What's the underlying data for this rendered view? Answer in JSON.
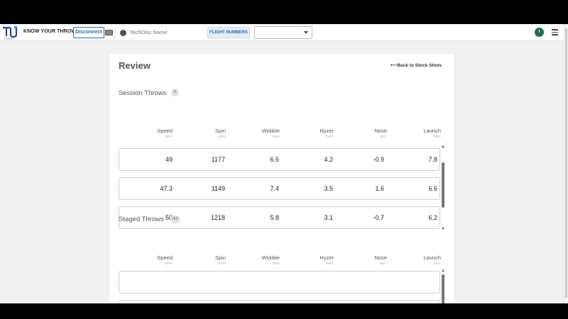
{
  "header": {
    "brand": "KNOW YOUR THROW",
    "disconnect_label": "Disconnect",
    "techdisc_placeholder": "TechDisc Name",
    "flight_numbers_label": "FLIGHT NUMBERS",
    "select_value": "",
    "avatar_initial": "I"
  },
  "review": {
    "title": "Review",
    "back_link": "⟵Back to Stock Shots"
  },
  "columns": [
    {
      "name": "Speed",
      "unit": "MPH"
    },
    {
      "name": "Spin",
      "unit": "RPM"
    },
    {
      "name": "Wobble",
      "unit": "DEG"
    },
    {
      "name": "Hyzer",
      "unit": "DEG"
    },
    {
      "name": "Nose",
      "unit": "DEG"
    },
    {
      "name": "Launch",
      "unit": "DEG"
    }
  ],
  "session": {
    "title": "Session Throws",
    "count": "5",
    "rows": [
      [
        "49",
        "1177",
        "6.5",
        "4.2",
        "-0.9",
        "7.8"
      ],
      [
        "47.3",
        "1149",
        "7.4",
        "3.5",
        "1.6",
        "6.6"
      ],
      [
        "50",
        "1218",
        "5.8",
        "3.1",
        "-0.7",
        "6.2"
      ]
    ]
  },
  "staged": {
    "title": "Staged Throws",
    "count": "0/3",
    "rows": [
      [
        "",
        "",
        "",
        "",
        "",
        ""
      ],
      [
        "",
        "",
        "",
        "",
        "",
        ""
      ]
    ]
  },
  "colors": {
    "accent": "#2a6ab1",
    "avatar": "#1f6f4a"
  }
}
